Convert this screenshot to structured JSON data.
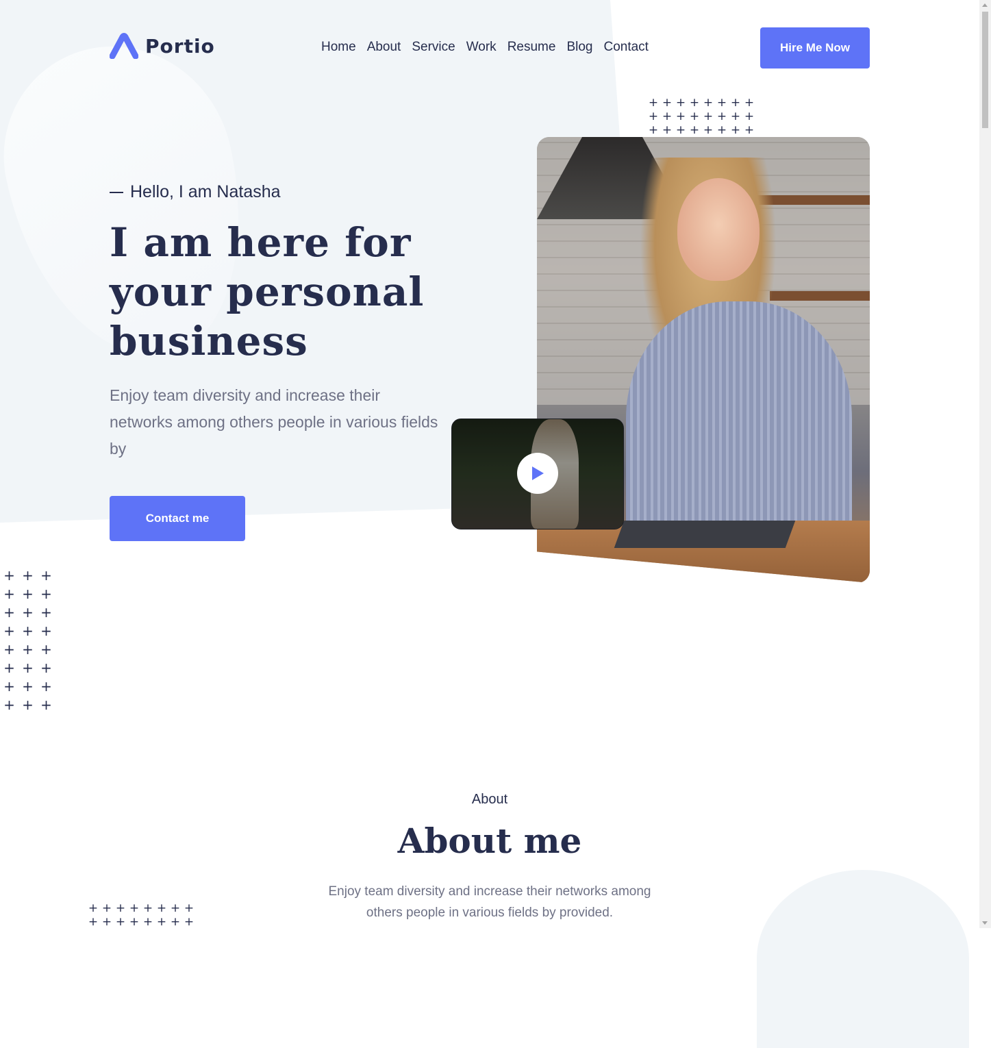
{
  "brand": {
    "name": "Portio",
    "accent": "#5e73f7",
    "dark": "#262d4d"
  },
  "nav": {
    "items": [
      {
        "label": "Home"
      },
      {
        "label": "About"
      },
      {
        "label": "Service"
      },
      {
        "label": "Work"
      },
      {
        "label": "Resume"
      },
      {
        "label": "Blog"
      },
      {
        "label": "Contact"
      }
    ],
    "cta_label": "Hire Me Now"
  },
  "hero": {
    "greeting": "Hello, I am Natasha",
    "headline": "I am here for your personal business",
    "description": "Enjoy team diversity and increase their networks among others people in various fields by",
    "cta_label": "Contact me",
    "play_icon": "play-icon"
  },
  "about": {
    "subtitle": "About",
    "title": "About me",
    "description": "Enjoy team diversity and increase their networks among others people in various fields by provided."
  },
  "decor": {
    "plus_glyph": "+"
  }
}
